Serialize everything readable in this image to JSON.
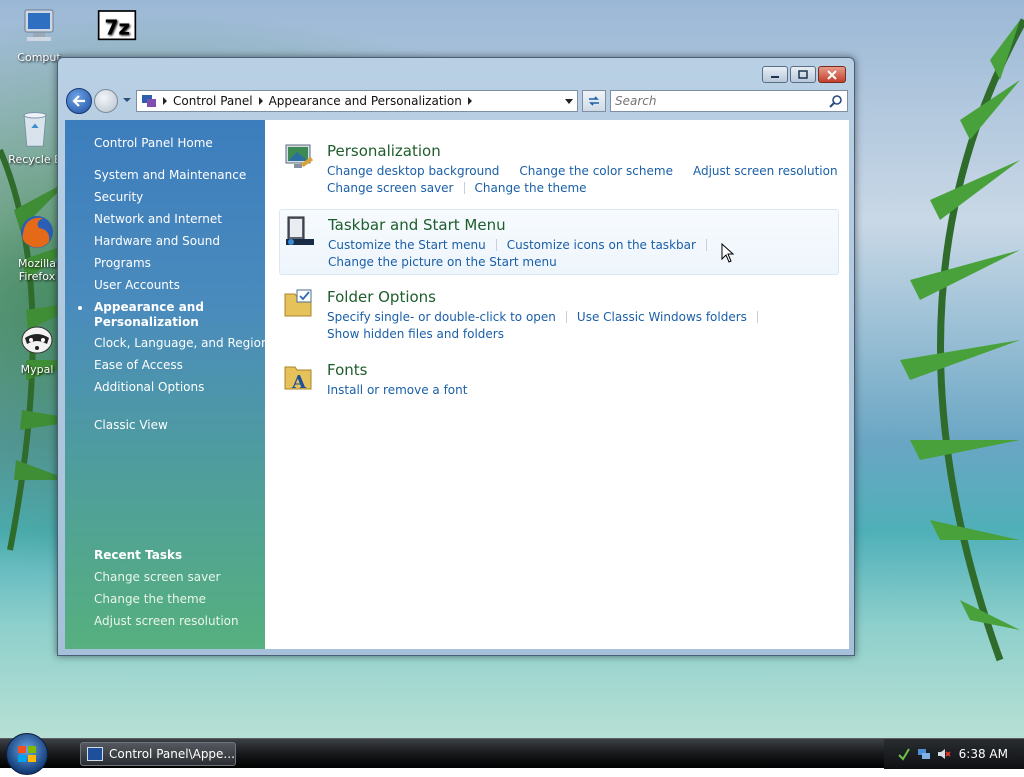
{
  "desktop": {
    "icons": [
      {
        "name": "computer",
        "label": "Comput"
      },
      {
        "name": "7zip",
        "label": ""
      },
      {
        "name": "recycle-bin",
        "label": "Recycle B"
      },
      {
        "name": "firefox",
        "label_line1": "Mozilla",
        "label_line2": "Firefox"
      },
      {
        "name": "mypal",
        "label": "Mypal"
      }
    ]
  },
  "window": {
    "address": {
      "crumbs": [
        "Control Panel",
        "Appearance and Personalization"
      ]
    },
    "search": {
      "placeholder": "Search"
    }
  },
  "sidebar": {
    "home": "Control Panel Home",
    "items": [
      {
        "label": "System and Maintenance"
      },
      {
        "label": "Security"
      },
      {
        "label": "Network and Internet"
      },
      {
        "label": "Hardware and Sound"
      },
      {
        "label": "Programs"
      },
      {
        "label": "User Accounts"
      },
      {
        "label_line1": "Appearance and",
        "label_line2": "Personalization",
        "active": true
      },
      {
        "label": "Clock, Language, and Region"
      },
      {
        "label": "Ease of Access"
      },
      {
        "label": "Additional Options"
      }
    ],
    "classic_view": "Classic View",
    "recent_tasks": {
      "title": "Recent Tasks",
      "items": [
        "Change screen saver",
        "Change the theme",
        "Adjust screen resolution"
      ]
    }
  },
  "categories": [
    {
      "title": "Personalization",
      "icon": "personalization-icon",
      "lines": [
        [
          "Change desktop background",
          "Change the color scheme",
          "Adjust screen resolution"
        ],
        [
          "Change screen saver",
          "Change the theme"
        ]
      ]
    },
    {
      "title": "Taskbar and Start Menu",
      "icon": "taskbar-icon",
      "lines": [
        [
          "Customize the Start menu",
          "Customize icons on the taskbar"
        ],
        [
          "Change the picture on the Start menu"
        ]
      ]
    },
    {
      "title": "Folder Options",
      "icon": "folder-options-icon",
      "lines": [
        [
          "Specify single- or double-click to open",
          "Use Classic Windows folders"
        ],
        [
          "Show hidden files and folders"
        ]
      ]
    },
    {
      "title": "Fonts",
      "icon": "fonts-icon",
      "lines": [
        [
          "Install or remove a font"
        ]
      ]
    }
  ],
  "taskbar": {
    "window_button": "Control Panel\\Appe...",
    "clock": "6:38 AM"
  }
}
